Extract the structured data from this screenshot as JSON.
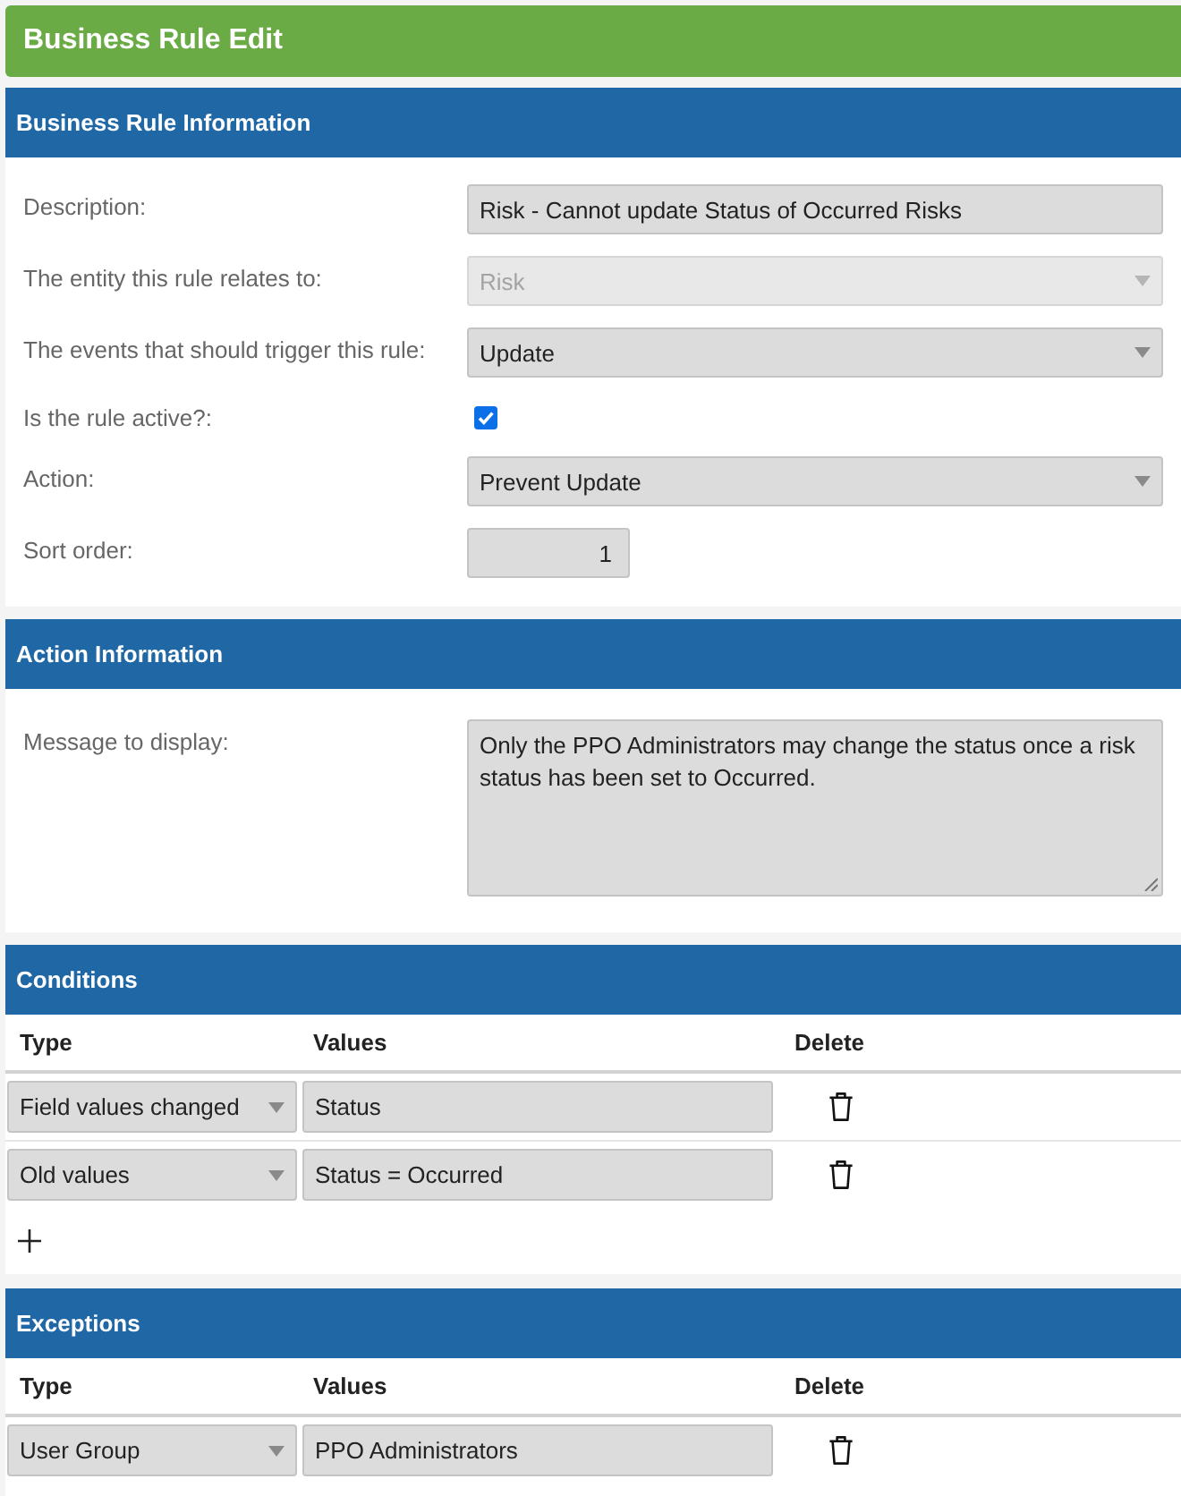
{
  "window": {
    "title": "Business Rule Edit"
  },
  "sections": [
    {
      "kind": "form",
      "title": "Business Rule Information",
      "fields": [
        {
          "kind": "text",
          "label": "Description:",
          "value": "Risk - Cannot update Status of Occurred Risks",
          "disabled": false
        },
        {
          "kind": "select",
          "label": "The entity this rule relates to:",
          "value": "Risk",
          "disabled": true
        },
        {
          "kind": "select",
          "label": "The events that should trigger this rule:",
          "value": "Update",
          "disabled": false
        },
        {
          "kind": "checkbox",
          "label": "Is the rule active?:",
          "checked": true
        },
        {
          "kind": "select",
          "label": "Action:",
          "value": "Prevent Update",
          "disabled": false
        },
        {
          "kind": "number",
          "label": "Sort order:",
          "value": "1",
          "disabled": false
        }
      ]
    },
    {
      "kind": "form",
      "title": "Action Information",
      "fields": [
        {
          "kind": "textarea",
          "label": "Message to display:",
          "value": "Only the PPO Administrators may change the status once a risk status has been set to Occurred.",
          "disabled": false
        }
      ]
    },
    {
      "kind": "table",
      "title": "Conditions",
      "columns": [
        "Type",
        "Values",
        "Delete"
      ],
      "rows": [
        {
          "type": "Field values changed",
          "values": "Status"
        },
        {
          "type": "Old values",
          "values": "Status = Occurred"
        }
      ],
      "can_add": true
    },
    {
      "kind": "table",
      "title": "Exceptions",
      "columns": [
        "Type",
        "Values",
        "Delete"
      ],
      "rows": [
        {
          "type": "User Group",
          "values": "PPO Administrators"
        }
      ],
      "can_add": false
    }
  ]
}
